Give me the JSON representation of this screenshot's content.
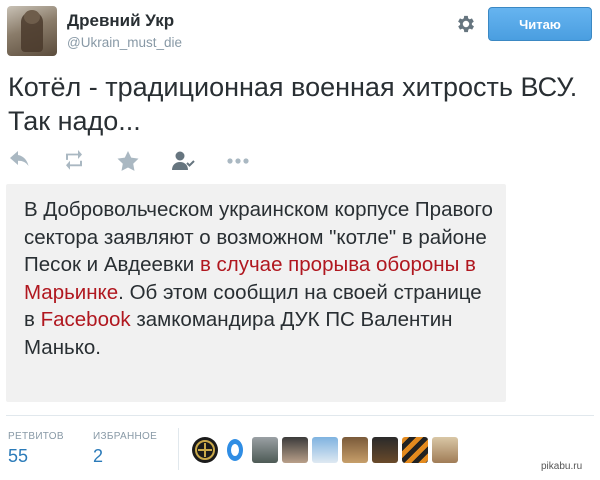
{
  "profile": {
    "name": "Древний Укр",
    "handle": "@Ukrain_must_die"
  },
  "toolbar": {
    "gear_icon": "gear-icon",
    "follow_label": "Читаю"
  },
  "tweet": {
    "text": "Котёл - традиционная военная хитрость ВСУ. Так надо..."
  },
  "actions": [
    "reply-icon",
    "retweet-icon",
    "favorite-icon",
    "follow-user-icon",
    "more-icon"
  ],
  "card": {
    "segments": [
      "В Добровольческом украинском корпусе Правого сектора заявляют о возможном \"котле\" в районе Песок и Авдеевки ",
      "в случае прорыва обороны в Марьинке",
      ". Об этом сообщил на своей странице в ",
      "Facebook",
      " замкомандира ДУК ПС Валентин Манько."
    ],
    "highlight_color": "#b0171f"
  },
  "stats": {
    "retweets_label": "РЕТВИТОВ",
    "retweets_count": "55",
    "favorites_label": "ИЗБРАННОЕ",
    "favorites_count": "2"
  },
  "favoriters": [
    "avatar-1",
    "avatar-2",
    "avatar-3",
    "avatar-4",
    "avatar-5",
    "avatar-6",
    "avatar-7",
    "avatar-8",
    "avatar-9"
  ],
  "watermark": "pikabu.ru",
  "colors": {
    "accent": "#4a9ee0",
    "link": "#2b7bb9",
    "muted": "#8899a6"
  }
}
